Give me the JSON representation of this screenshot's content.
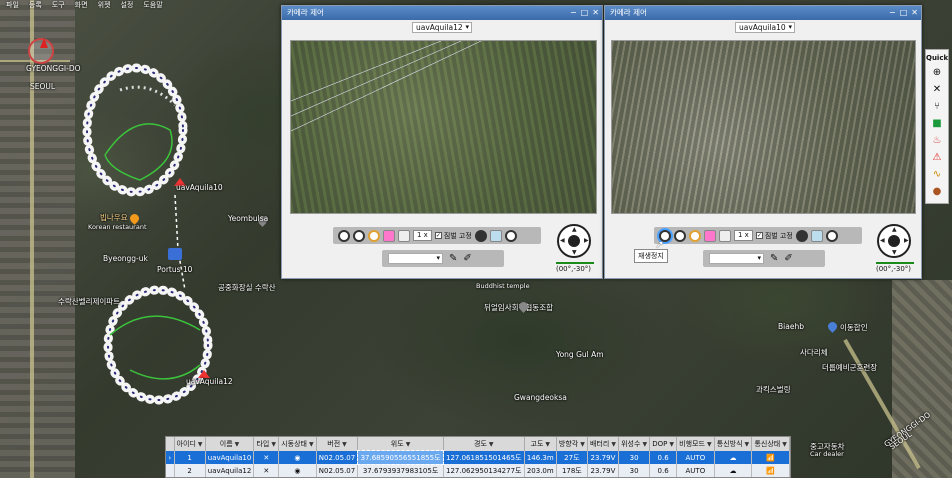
{
  "menu": [
    "파일",
    "등록",
    "도구",
    "화면",
    "위젯",
    "설정",
    "도움말"
  ],
  "map_labels": [
    {
      "text": "GYEONGGI-DO",
      "cls": "m1"
    },
    {
      "text": "SEOUL",
      "cls": "m2"
    },
    {
      "text": "빕나우요",
      "cls": "m3"
    },
    {
      "text": "Korean restaurant",
      "cls": "m4"
    },
    {
      "text": "Byeongg-uk",
      "cls": "m5"
    },
    {
      "text": "Portus 10",
      "cls": "m6"
    },
    {
      "text": "수락산벨리제이파트",
      "cls": "m7"
    },
    {
      "text": "Yeombulsa",
      "cls": "m8"
    },
    {
      "text": "공중화장실 수락산",
      "cls": "m9"
    },
    {
      "text": "Buddhist temple",
      "cls": "m10"
    },
    {
      "text": "뒤얼임사회적협동조합",
      "cls": "m11"
    },
    {
      "text": "Yong Gul Am",
      "cls": "m12"
    },
    {
      "text": "Gwangdeoksa",
      "cls": "m13"
    },
    {
      "text": "Biaehb",
      "cls": "m14"
    },
    {
      "text": "이동합인",
      "cls": "m15"
    },
    {
      "text": "사다리체",
      "cls": "m16"
    },
    {
      "text": "더룹예비군훈련장",
      "cls": "m17"
    },
    {
      "text": "과킥스벌링",
      "cls": "m18"
    },
    {
      "text": "중고자동차",
      "cls": "m19"
    },
    {
      "text": "Car dealer",
      "cls": "m20"
    },
    {
      "text": "GYEONGGI-DO",
      "cls": "m21"
    },
    {
      "text": "SEOUL",
      "cls": "m22"
    },
    {
      "text": "uavAquila10",
      "cls": "m23"
    },
    {
      "text": "uavAquila12",
      "cls": "m24"
    }
  ],
  "camera_windows": [
    {
      "title": "카메라 제어",
      "uav": "uavAquila12",
      "zoom": "1 x",
      "fix_label": "짐벌 고정",
      "gimbal_value": "(00°,-30°)"
    },
    {
      "title": "카메라 제어",
      "uav": "uavAquila10",
      "zoom": "1 x",
      "fix_label": "짐벌 고정",
      "gimbal_value": "(00°,-30°)"
    }
  ],
  "win_buttons": {
    "minimize": "−",
    "maximize": "□",
    "close": "✕"
  },
  "tooltip": "재생정지",
  "quick": {
    "title": "Quick"
  },
  "grid": {
    "headers": [
      "아이디",
      "이름",
      "타입",
      "시동상태",
      "버전",
      "위도",
      "경도",
      "고도",
      "방향각",
      "배터리",
      "위성수",
      "DOP",
      "비행모드",
      "통신방식",
      "통신상태"
    ],
    "rows": [
      {
        "id": "1",
        "name": "uavAquila10",
        "type": "✕",
        "engine": "◉",
        "version": "N02.05.07",
        "lat": "37.68590556551855도",
        "lon": "127.061851501465도",
        "alt": "146.3m",
        "heading": "27도",
        "battery": "23.79V",
        "sats": "30",
        "dop": "0.6",
        "mode": "AUTO",
        "comm": "☁",
        "status": "📶"
      },
      {
        "id": "2",
        "name": "uavAquila12",
        "type": "✕",
        "engine": "◉",
        "version": "N02.05.07",
        "lat": "37.6793937983105도",
        "lon": "127.062950134277도",
        "alt": "203.0m",
        "heading": "178도",
        "battery": "23.79V",
        "sats": "30",
        "dop": "0.6",
        "mode": "AUTO",
        "comm": "☁",
        "status": "📶"
      }
    ]
  },
  "colors": {
    "selected_row": "#1a6fd6",
    "title_bar": "#4a7cc0",
    "gimbal_line": "#1a8a1a"
  }
}
